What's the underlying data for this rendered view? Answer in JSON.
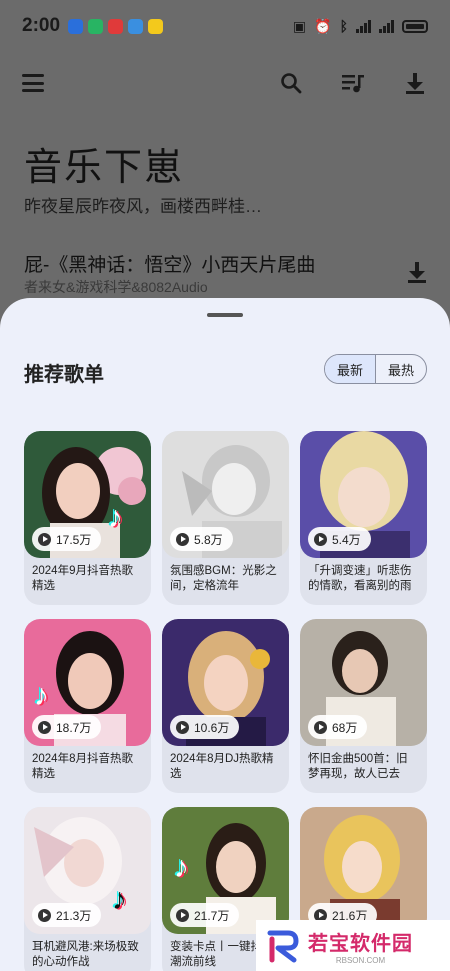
{
  "status_bar": {
    "time": "2:00",
    "notifications": [
      {
        "icon": "app-notif-icon",
        "color": "#2a6fdb"
      },
      {
        "icon": "app-notif-icon",
        "color": "#28b463"
      },
      {
        "icon": "app-notif-icon",
        "color": "#e03a3a"
      },
      {
        "icon": "app-notif-icon",
        "color": "#3a8fe0"
      },
      {
        "icon": "app-notif-icon",
        "color": "#f3c91c"
      }
    ]
  },
  "toolbar": {
    "menu_icon": "menu-icon",
    "search_icon": "search-icon",
    "playlist_icon": "playlist-icon",
    "download_icon": "download-icon"
  },
  "hero": {
    "title": "音乐下崽",
    "subtitle": "昨夜星辰昨夜风，画楼西畔桂…"
  },
  "now_playing": {
    "title": "屁-《黑神话：悟空》小西天片尾曲",
    "artist": "者来女&游戏科学&8082Audio"
  },
  "sheet": {
    "title": "推荐歌单",
    "toggle": {
      "newest": "最新",
      "hottest": "最热"
    }
  },
  "playlists": [
    {
      "plays": "17.5万",
      "title": "2024年9月抖音热歌精选"
    },
    {
      "plays": "5.8万",
      "title": "氛围感BGM：光影之间，定格流年"
    },
    {
      "plays": "5.4万",
      "title": "「升调变速」听悲伤的情歌，看离别的雨"
    },
    {
      "plays": "18.7万",
      "title": "2024年8月抖音热歌精选"
    },
    {
      "plays": "10.6万",
      "title": "2024年8月DJ热歌精选"
    },
    {
      "plays": "68万",
      "title": "怀旧金曲500首：旧梦再现，故人已去"
    },
    {
      "plays": "21.3万",
      "title": "耳机避风港:来场极致的心动作战"
    },
    {
      "plays": "21.7万",
      "title": "变装卡点丨一键抖音潮流前线"
    },
    {
      "plays": "21.6万",
      "title": ""
    }
  ],
  "watermark": {
    "text": "若宝软件园",
    "url": "RBSON.COM"
  }
}
